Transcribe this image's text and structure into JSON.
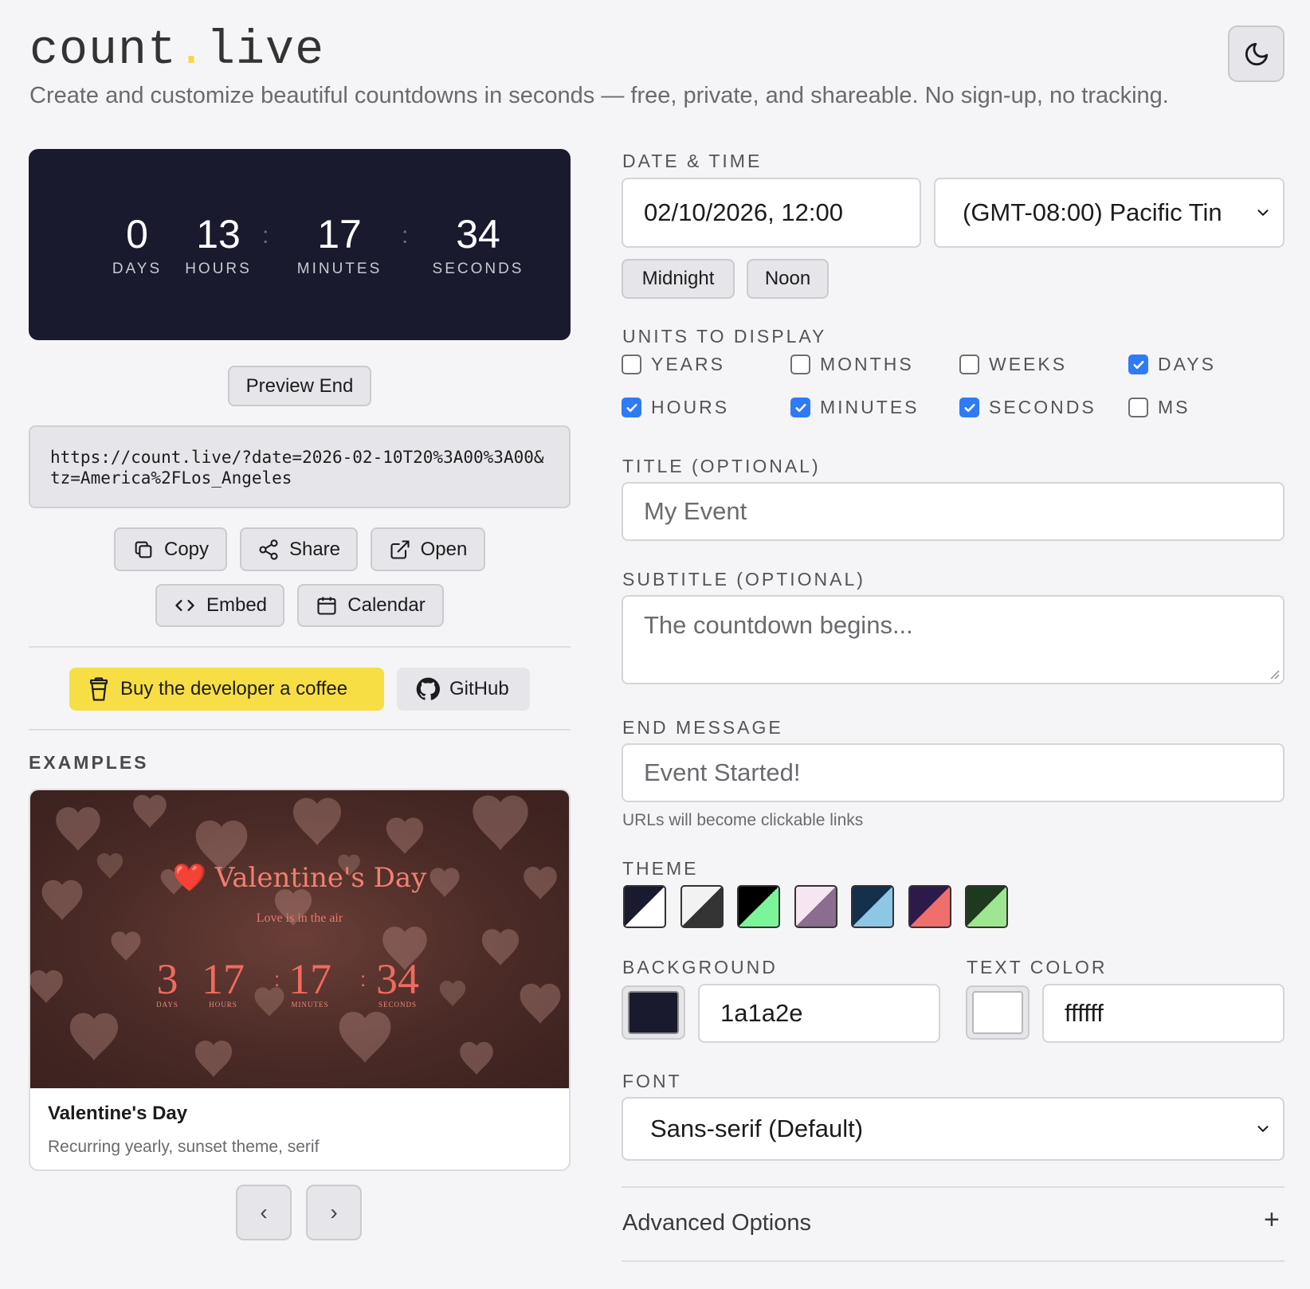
{
  "header": {
    "logo_part1": "count",
    "logo_dot": ".",
    "logo_part2": "live",
    "tagline": "Create and customize beautiful countdowns in seconds — free, private, and shareable. No sign-up, no tracking."
  },
  "preview": {
    "units": [
      {
        "value": "0",
        "label": "DAYS"
      },
      {
        "value": "13",
        "label": "HOURS"
      },
      {
        "value": "17",
        "label": "MINUTES"
      },
      {
        "value": "34",
        "label": "SECONDS"
      }
    ],
    "separator": ":",
    "background": "#1a1a2e",
    "preview_end_label": "Preview End"
  },
  "share": {
    "url": "https://count.live/?date=2026-02-10T20%3A00%3A00&tz=America%2FLos_Angeles",
    "copy_label": "Copy",
    "share_label": "Share",
    "open_label": "Open",
    "embed_label": "Embed",
    "calendar_label": "Calendar"
  },
  "support": {
    "coffee_label": "Buy the developer a coffee",
    "github_label": "GitHub",
    "coffee_color": "#f7de45"
  },
  "examples": {
    "section_label": "EXAMPLES",
    "current": {
      "heading_emoji": "❤️",
      "heading": "Valentine's Day",
      "subheading": "Love is in the air",
      "units": [
        {
          "value": "3",
          "label": "DAYS"
        },
        {
          "value": "17",
          "label": "HOURS"
        },
        {
          "value": "17",
          "label": "MINUTES"
        },
        {
          "value": "34",
          "label": "SECONDS"
        }
      ],
      "name": "Valentine's Day",
      "description": "Recurring yearly, sunset theme, serif"
    },
    "prev_label": "‹",
    "next_label": "›"
  },
  "form": {
    "datetime": {
      "label": "DATE & TIME",
      "date_value": "02/10/2026, 12:00",
      "timezone_value": "(GMT-08:00) Pacific Tin",
      "midnight_label": "Midnight",
      "noon_label": "Noon"
    },
    "units": {
      "label": "UNITS TO DISPLAY",
      "options": [
        {
          "label": "YEARS",
          "checked": false
        },
        {
          "label": "MONTHS",
          "checked": false
        },
        {
          "label": "WEEKS",
          "checked": false
        },
        {
          "label": "DAYS",
          "checked": true
        },
        {
          "label": "HOURS",
          "checked": true
        },
        {
          "label": "MINUTES",
          "checked": true
        },
        {
          "label": "SECONDS",
          "checked": true
        },
        {
          "label": "MS",
          "checked": false
        }
      ]
    },
    "title": {
      "label": "TITLE (OPTIONAL)",
      "placeholder": "My Event"
    },
    "subtitle": {
      "label": "SUBTITLE (OPTIONAL)",
      "placeholder": "The countdown begins..."
    },
    "end_message": {
      "label": "END MESSAGE",
      "placeholder": "Event Started!",
      "hint": "URLs will become clickable links"
    },
    "theme": {
      "label": "THEME",
      "swatches": [
        {
          "a": "#1a1a2e",
          "b": "#ffffff"
        },
        {
          "a": "#f2f2f2",
          "b": "#333333"
        },
        {
          "a": "#000000",
          "b": "#7cf59a"
        },
        {
          "a": "#f7e6f2",
          "b": "#8a6d8f"
        },
        {
          "a": "#14304a",
          "b": "#8ec6e6"
        },
        {
          "a": "#2e1a4a",
          "b": "#ef6f6c"
        },
        {
          "a": "#1e3a1e",
          "b": "#9ee68f"
        }
      ]
    },
    "background": {
      "label": "BACKGROUND",
      "value": "1a1a2e",
      "color": "#1a1a2e"
    },
    "text_color": {
      "label": "TEXT COLOR",
      "value": "ffffff",
      "color": "#ffffff"
    },
    "font": {
      "label": "FONT",
      "value": "Sans-serif (Default)"
    },
    "advanced": {
      "label": "Advanced Options",
      "toggle": "+"
    }
  }
}
